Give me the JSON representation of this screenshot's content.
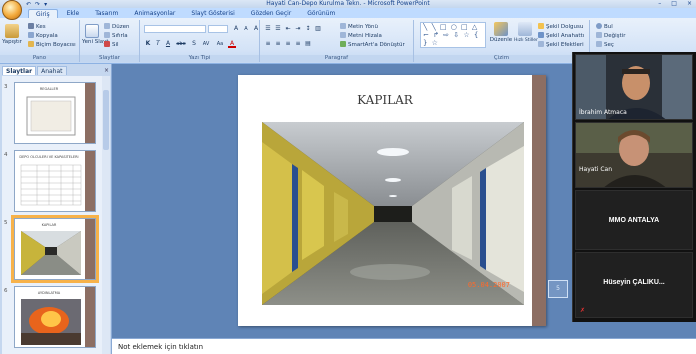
{
  "window": {
    "title": "Hayati Can-Depo Kurulma Tekn. - Microsoft PowerPoint",
    "min": "–",
    "max": "□",
    "close": "×"
  },
  "qat": {
    "undo": "↶",
    "redo": "↷",
    "more": "▾"
  },
  "tabs": [
    {
      "label": "Giriş",
      "active": true
    },
    {
      "label": "Ekle"
    },
    {
      "label": "Tasarım"
    },
    {
      "label": "Animasyonlar"
    },
    {
      "label": "Slayt Gösterisi"
    },
    {
      "label": "Gözden Geçir"
    },
    {
      "label": "Görünüm"
    }
  ],
  "ribbon": {
    "clipboard": {
      "label": "Pano",
      "paste": "Yapıştır",
      "cut": "Kes",
      "copy": "Kopyala",
      "format_painter": "Biçim Boyacısı"
    },
    "slides": {
      "label": "Slaytlar",
      "new_slide": "Yeni Slayt",
      "layout": "Düzen",
      "reset": "Sıfırla",
      "delete": "Sil"
    },
    "font": {
      "label": "Yazı Tipi",
      "font_name": "",
      "font_size": "",
      "grow": "A",
      "shrink": "A",
      "clear": "A",
      "bold": "K",
      "italic": "T",
      "underline": "A",
      "strike": "abe",
      "shadow": "S",
      "spacing": "AV",
      "case": "Aa",
      "color": "A"
    },
    "paragraph": {
      "label": "Paragraf",
      "text_direction": "Metin Yönü",
      "align_text": "Metni Hizala",
      "smartart": "SmartArt'a Dönüştür"
    },
    "drawing": {
      "label": "Çizim",
      "shapes": "╲ ╲ □ ○ □ △ ⌐ ↱ ⇨ ⇩ ☆ { } ☆",
      "arrange": "Düzenle",
      "quick_styles": "Hızlı Stiller",
      "shape_fill": "Şekil Dolgusu",
      "shape_outline": "Şekil Anahattı",
      "shape_effects": "Şekil Efektleri"
    },
    "editing": {
      "find": "Bul",
      "replace": "Değiştir",
      "select": "Seç"
    }
  },
  "pane": {
    "tab_slides": "Slaytlar",
    "tab_outline": "Anahat",
    "close": "×",
    "thumbs": [
      {
        "num": "3",
        "title": "REGALLER"
      },
      {
        "num": "4",
        "title": "DEPO OLCULERI VE KAPASITELERI"
      },
      {
        "num": "5",
        "title": "KAPILAR",
        "selected": true
      },
      {
        "num": "6",
        "title": "AYDINLATMA"
      }
    ]
  },
  "slide": {
    "heading": "KAPILAR",
    "date_stamp": "05.04.2007",
    "number": "5"
  },
  "notes": {
    "placeholder": "Not eklemek için tıklatın"
  },
  "participants": [
    {
      "name": "İbrahim Atmaca",
      "type": "video"
    },
    {
      "name": "Hayati Can",
      "type": "video"
    },
    {
      "name": "MMO ANTALYA",
      "type": "name"
    },
    {
      "name": "Hüseyin ÇALIKU...",
      "type": "name",
      "muted": true
    }
  ],
  "colors": {
    "ribbon": "#d4e3f7",
    "workspace": "#5f84b6",
    "accent_bar": "#8c6e63",
    "selection": "#f7b24a"
  }
}
